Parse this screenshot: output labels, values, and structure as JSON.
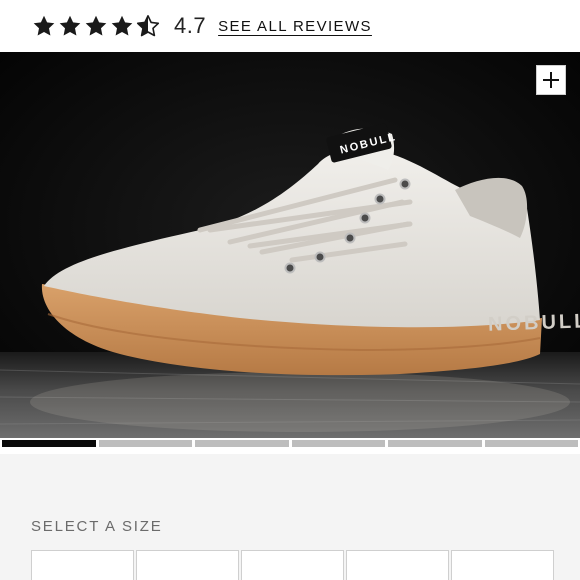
{
  "rating": {
    "stars": [
      "full",
      "full",
      "full",
      "full",
      "half"
    ],
    "value": "4.7",
    "link_label": "SEE ALL REVIEWS"
  },
  "gallery": {
    "image": "white canvas lace-up trainer with gum rubber sole",
    "brand_mark": "NOBULL",
    "zoom_icon": "plus-icon",
    "count": 6,
    "active_index": 0
  },
  "size_selector": {
    "label": "SELECT A SIZE",
    "visible_options": 5
  },
  "colors": {
    "star": "#1a1a1a",
    "hero_background": "#050505",
    "sole": "#c98f5a",
    "upper": "#e6e3de",
    "active_indicator": "#0a0a0a",
    "inactive_indicator": "#bdbdbd",
    "panel_background": "#f4f4f4"
  }
}
